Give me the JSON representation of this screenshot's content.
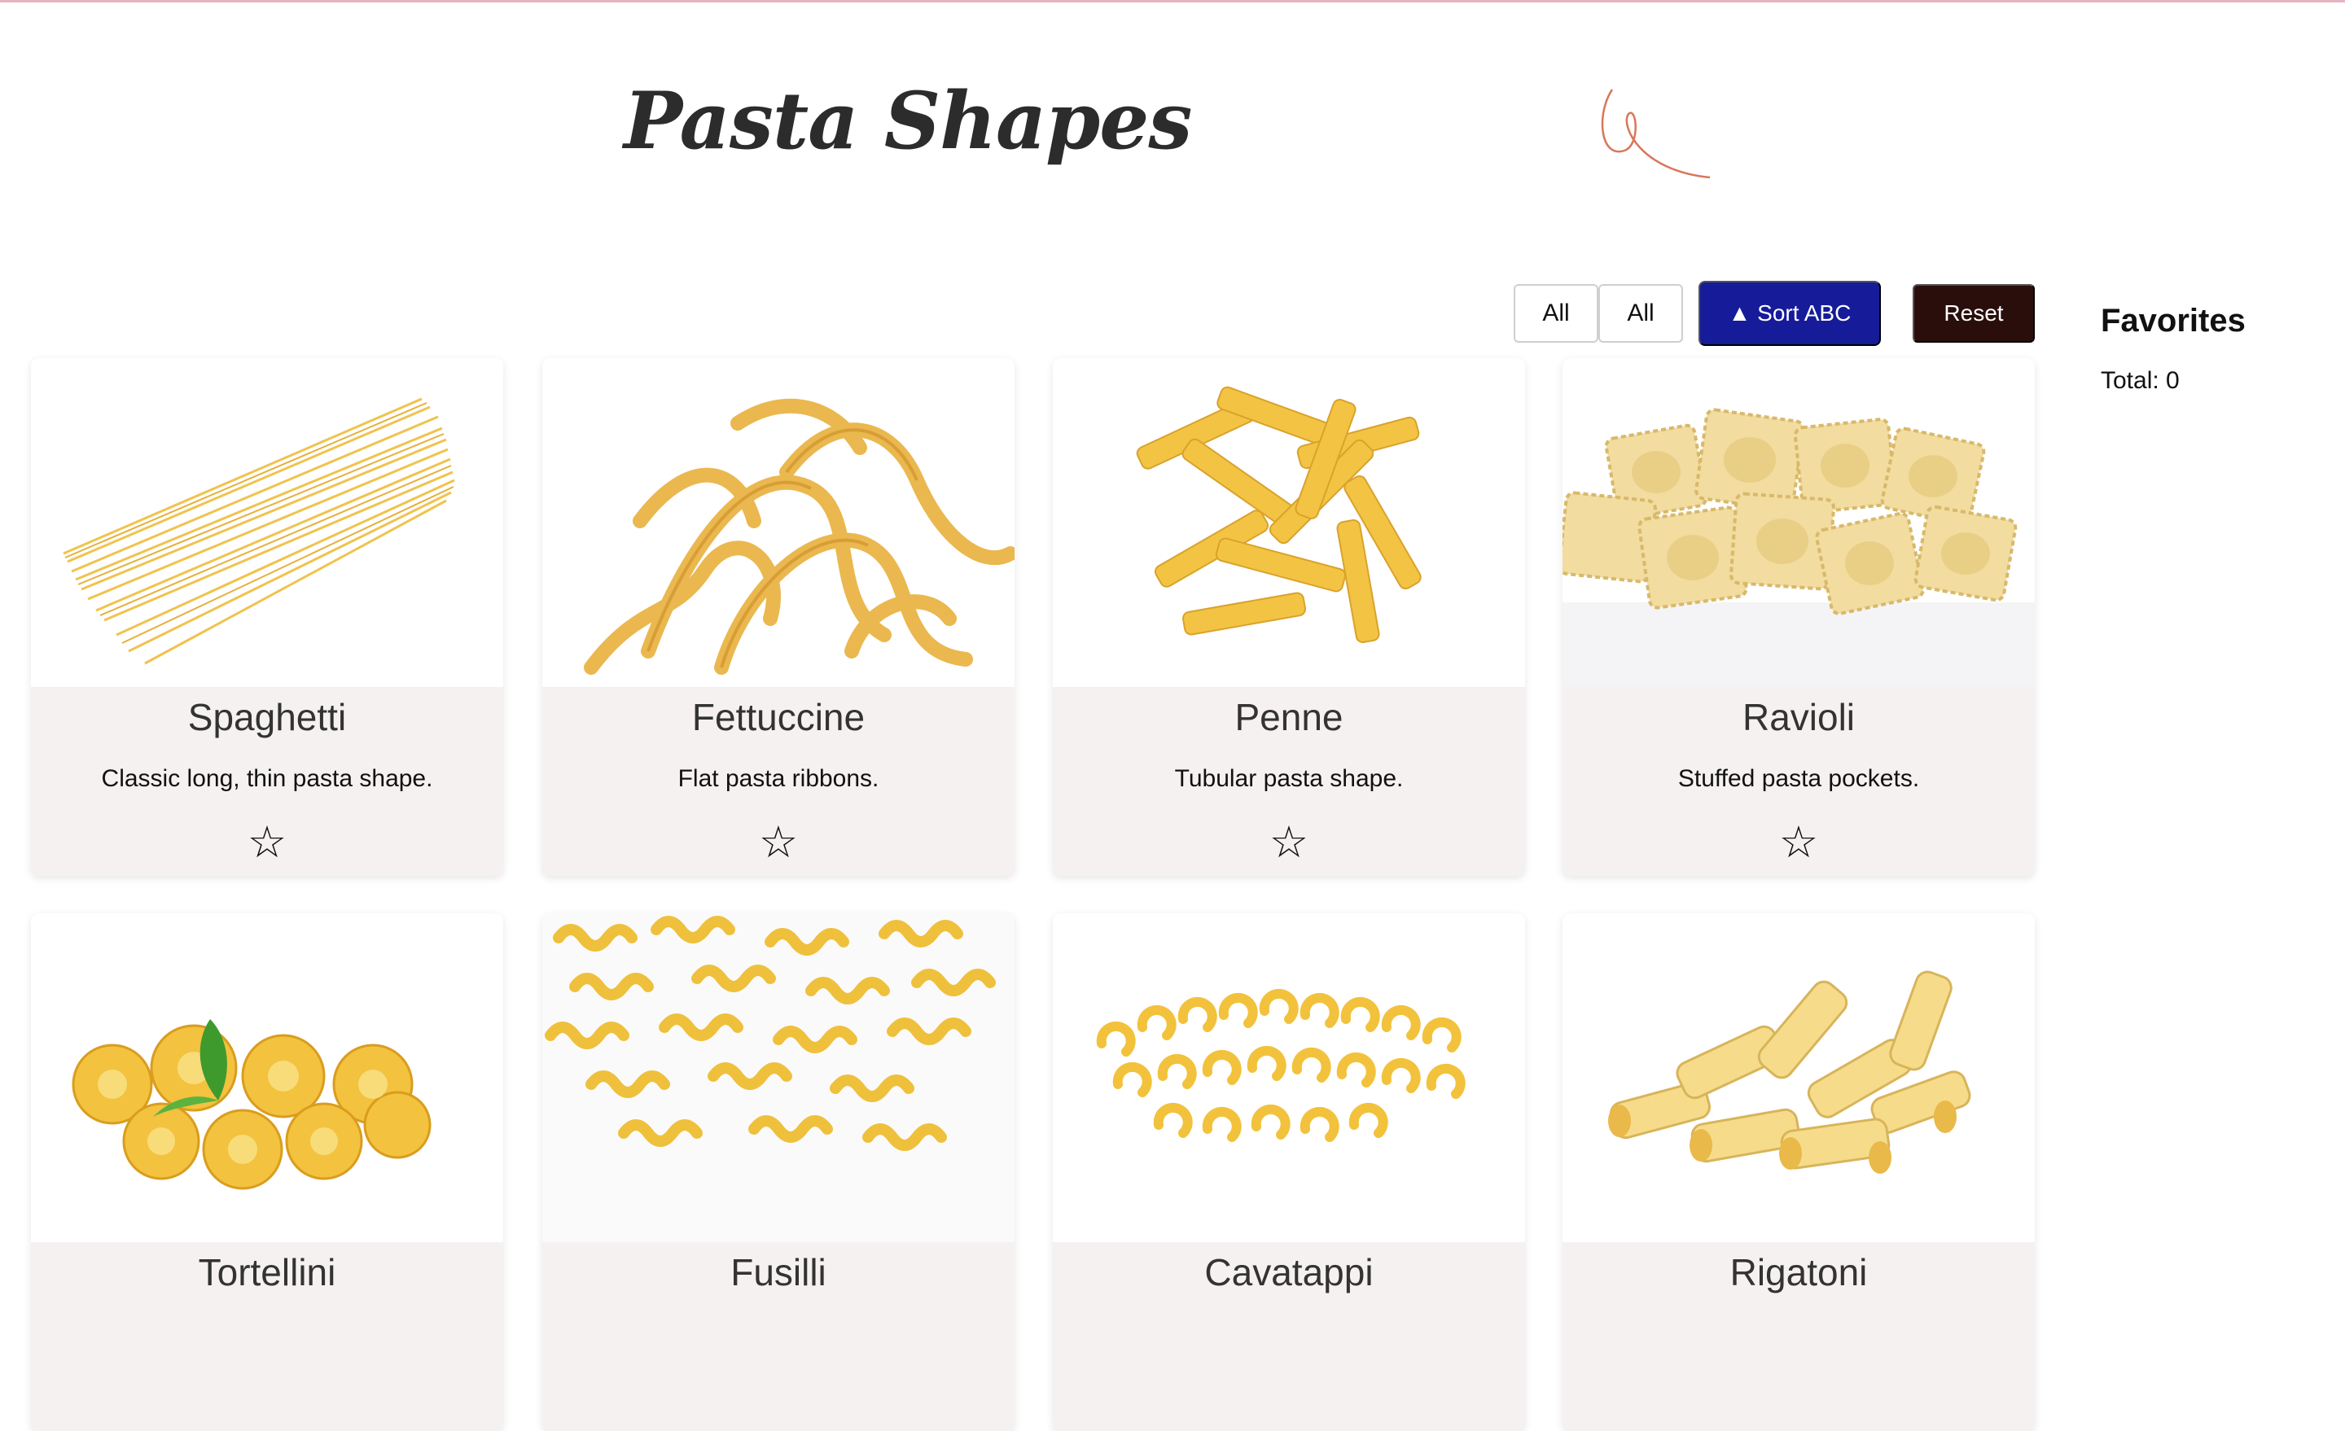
{
  "header": {
    "title": "Pasta Shapes"
  },
  "controls": {
    "filter_all_1": "All",
    "filter_all_2": "All",
    "sort_label": "▲ Sort ABC",
    "reset_label": "Reset"
  },
  "favorites": {
    "title": "Favorites",
    "total": "Total: 0"
  },
  "star_glyph": "☆",
  "cards": [
    {
      "name": "Spaghetti",
      "description": "Classic long, thin pasta shape."
    },
    {
      "name": "Fettuccine",
      "description": "Flat pasta ribbons."
    },
    {
      "name": "Penne",
      "description": "Tubular pasta shape."
    },
    {
      "name": "Ravioli",
      "description": "Stuffed pasta pockets."
    },
    {
      "name": "Tortellini",
      "description": ""
    },
    {
      "name": "Fusilli",
      "description": ""
    },
    {
      "name": "Cavatappi",
      "description": ""
    },
    {
      "name": "Rigatoni",
      "description": ""
    }
  ],
  "colors": {
    "accent_blue": "#161b9a",
    "reset_dark": "#2a0e0c",
    "card_bg": "#f6f1f1",
    "pasta_yellow": "#f2c24a"
  }
}
